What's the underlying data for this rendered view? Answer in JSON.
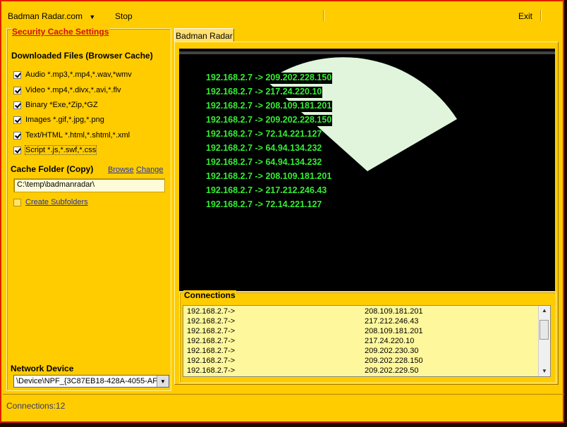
{
  "menu": {
    "site": "Badman Radar.com",
    "stop": "Stop",
    "exit": "Exit"
  },
  "left": {
    "group_title": "Security Cache Settings",
    "downloaded_title": "Downloaded Files  (Browser Cache)",
    "filetypes": [
      {
        "label": "Audio *.mp3,*.mp4,*.wav,*wmv",
        "checked": true
      },
      {
        "label": "Video *.mp4,*.divx,*.avi,*.flv",
        "checked": true
      },
      {
        "label": "Binary *Exe,*Zip,*GZ",
        "checked": true
      },
      {
        "label": "Images *.gif,*.jpg,*.png",
        "checked": true
      },
      {
        "label": "Text/HTML *.html,*.shtml,*.xml",
        "checked": true
      },
      {
        "label": "Script *.js,*.swf,*.css",
        "checked": true
      }
    ],
    "cache_folder_label": "Cache Folder (Copy)",
    "browse_link": "Browse",
    "change_link": "Change",
    "cache_folder_value": "C:\\temp\\badmanradar\\",
    "create_subfolders": {
      "label": "Create Subfolders",
      "checked": false
    },
    "network_device_label": "Network Device",
    "network_device_value": "\\Device\\NPF_{3C87EB18-428A-4055-AF"
  },
  "tab": {
    "label": "Badman Radar"
  },
  "radar": {
    "lines": [
      "192.168.2.7 -> 209.202.228.150",
      "192.168.2.7 -> 217.24.220.10",
      "192.168.2.7 -> 208.109.181.201",
      "192.168.2.7 -> 209.202.228.150",
      "192.168.2.7 -> 72.14.221.127",
      "192.168.2.7 -> 64.94.134.232",
      "192.168.2.7 -> 64.94.134.232",
      "192.168.2.7 -> 208.109.181.201",
      "192.168.2.7 -> 217.212.246.43",
      "192.168.2.7 -> 72.14.221.127"
    ],
    "text_color": "#33ee33",
    "sweep_color": "#e0f5dc"
  },
  "connections": {
    "title": "Connections",
    "rows": [
      {
        "src": "192.168.2.7->",
        "dst": "208.109.181.201"
      },
      {
        "src": "192.168.2.7->",
        "dst": "217.212.246.43"
      },
      {
        "src": "192.168.2.7->",
        "dst": "208.109.181.201"
      },
      {
        "src": "192.168.2.7->",
        "dst": "217.24.220.10"
      },
      {
        "src": "192.168.2.7->",
        "dst": "209.202.230.30"
      },
      {
        "src": "192.168.2.7->",
        "dst": "209.202.228.150"
      },
      {
        "src": "192.168.2.7->",
        "dst": "209.202.229.50"
      }
    ]
  },
  "status": {
    "text": "Connections:12"
  }
}
